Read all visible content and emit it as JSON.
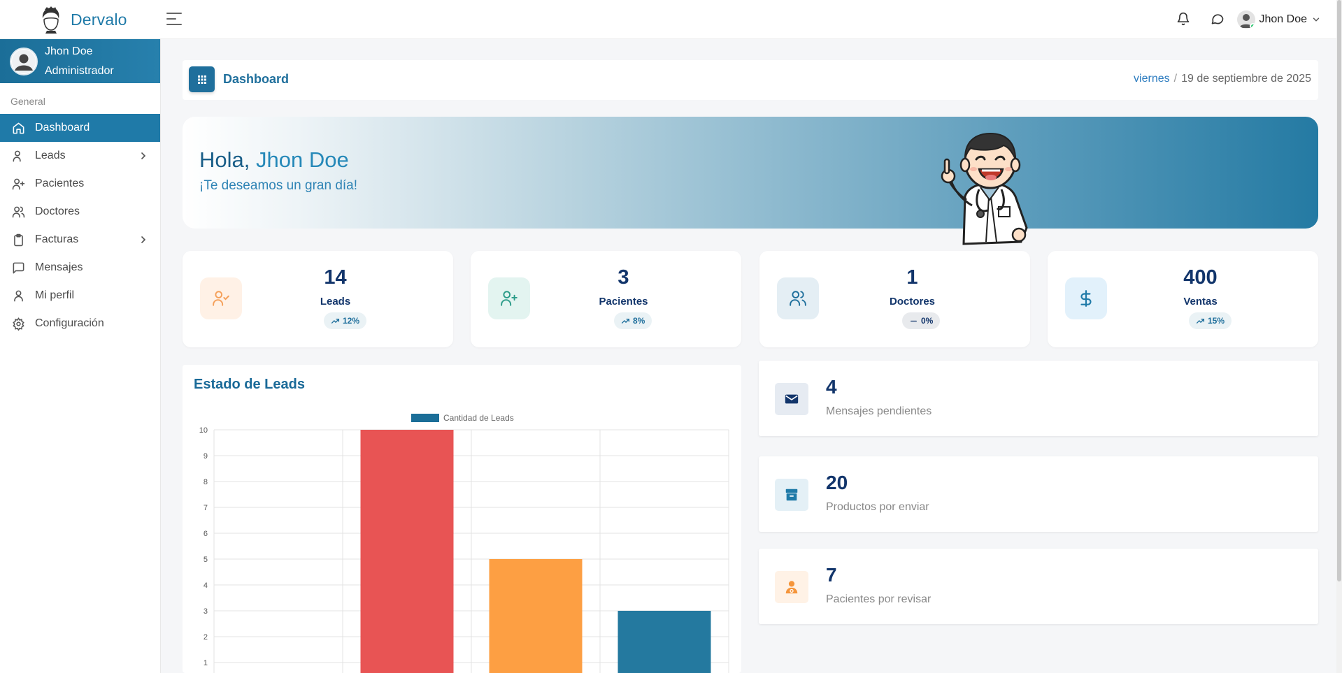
{
  "brand": {
    "name": "Dervalo"
  },
  "topbar": {
    "user_name": "Jhon Doe"
  },
  "sidebar": {
    "profile": {
      "name": "Jhon Doe",
      "role": "Administrador"
    },
    "section_label": "General",
    "items": [
      {
        "label": "Dashboard",
        "icon": "home-icon",
        "active": true
      },
      {
        "label": "Leads",
        "icon": "user-check-icon",
        "has_submenu": true
      },
      {
        "label": "Pacientes",
        "icon": "user-plus-icon"
      },
      {
        "label": "Doctores",
        "icon": "users-icon"
      },
      {
        "label": "Facturas",
        "icon": "clipboard-icon",
        "has_submenu": true
      },
      {
        "label": "Mensajes",
        "icon": "message-square-icon"
      },
      {
        "label": "Mi perfil",
        "icon": "user-icon"
      },
      {
        "label": "Configuración",
        "icon": "settings-icon"
      }
    ]
  },
  "header": {
    "title": "Dashboard",
    "day": "viernes",
    "date": "19 de septiembre de 2025"
  },
  "hero": {
    "greeting": "Hola,",
    "name": "Jhon Doe",
    "subtitle": "¡Te deseamos un gran día!"
  },
  "stats": [
    {
      "value": "14",
      "label": "Leads",
      "trend": "12%",
      "trend_icon": "trending-up-icon",
      "color": "#f5a05a",
      "bg": "#fff1e6"
    },
    {
      "value": "3",
      "label": "Pacientes",
      "trend": "8%",
      "trend_icon": "trending-up-icon",
      "color": "#2c9c89",
      "bg": "#e3f4f0"
    },
    {
      "value": "1",
      "label": "Doctores",
      "trend": "0%",
      "trend_icon": "minus-icon",
      "color": "#1f6f9c",
      "bg": "#e4eef4"
    },
    {
      "value": "400",
      "label": "Ventas",
      "trend": "15%",
      "trend_icon": "trending-up-icon",
      "color": "#1f7aa8",
      "bg": "#e2f1fb"
    }
  ],
  "chart": {
    "title": "Estado de Leads"
  },
  "chart_data": {
    "type": "bar",
    "categories": [
      "",
      "",
      "",
      ""
    ],
    "series": [
      {
        "name": "Cantidad de Leads",
        "values": [
          0,
          10,
          5,
          3
        ],
        "colors": [
          "#e85454",
          "#e85454",
          "#fd9f43",
          "#24799f"
        ]
      }
    ],
    "ylim": [
      0,
      10
    ],
    "yticks": [
      1,
      2,
      3,
      4,
      5,
      6,
      7,
      8,
      9,
      10
    ],
    "legend": "top-center",
    "grid": true
  },
  "info_cards": [
    {
      "value": "4",
      "label": "Mensajes pendientes",
      "icon": "envelope-icon",
      "color": "#12356b",
      "bg": "#e6ebf2"
    },
    {
      "value": "20",
      "label": "Productos por enviar",
      "icon": "box-icon",
      "color": "#1f7aa8",
      "bg": "#e4f0f6"
    },
    {
      "value": "7",
      "label": "Pacientes por revisar",
      "icon": "user-medical-icon",
      "color": "#f5953a",
      "bg": "#fff2e6"
    }
  ]
}
